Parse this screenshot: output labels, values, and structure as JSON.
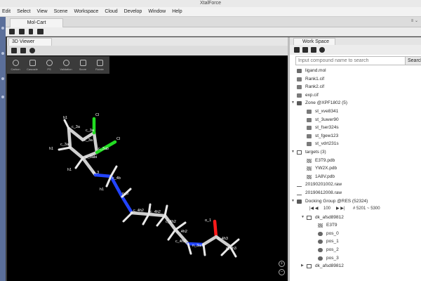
{
  "window_title": "XtalForce",
  "menu": [
    "Edit",
    "Select",
    "View",
    "Scene",
    "Workspace",
    "Cloud",
    "Develop",
    "Window",
    "Help"
  ],
  "main_tab": "Mol-Cart",
  "viewer": {
    "tab_label": "3D Viewer",
    "tools": [
      "Carbon",
      "Cascade",
      "PS",
      "Validation",
      "Score",
      "Rotate"
    ]
  },
  "workspace": {
    "tab_label": "Work Space",
    "search_placeholder": "Input compound name to search",
    "search_button": "Search",
    "pager": "100",
    "pager_range": "# 5201 ~ 5300",
    "items": [
      {
        "label": "ligand.mol",
        "icon": "mol",
        "level": 1,
        "arrow": ""
      },
      {
        "label": "Rank1.cif",
        "icon": "file",
        "level": 1,
        "arrow": ""
      },
      {
        "label": "Rank2.cif",
        "icon": "file",
        "level": 1,
        "arrow": ""
      },
      {
        "label": "exp.cif",
        "icon": "file",
        "level": 1,
        "arrow": ""
      },
      {
        "label": "Zone @XPF1802 (5)",
        "icon": "group",
        "level": 1,
        "arrow": "▼"
      },
      {
        "label": "st_xve8341",
        "icon": "file",
        "level": 2,
        "arrow": ""
      },
      {
        "label": "st_3uwer90",
        "icon": "file",
        "level": 2,
        "arrow": ""
      },
      {
        "label": "st_fser324s",
        "icon": "file",
        "level": 2,
        "arrow": ""
      },
      {
        "label": "st_fgew123",
        "icon": "file",
        "level": 2,
        "arrow": ""
      },
      {
        "label": "st_vdrt231s",
        "icon": "file",
        "level": 2,
        "arrow": ""
      },
      {
        "label": "targets (3)",
        "icon": "folder",
        "level": 1,
        "arrow": "▼"
      },
      {
        "label": "E3T9.pdb",
        "icon": "pdb",
        "level": 2,
        "arrow": ""
      },
      {
        "label": "YW2X.pdb",
        "icon": "pdb",
        "level": 2,
        "arrow": ""
      },
      {
        "label": "1A8V.pdb",
        "icon": "pdb",
        "level": 2,
        "arrow": ""
      },
      {
        "label": "20190201002.raw",
        "icon": "raw",
        "level": 1,
        "arrow": ""
      },
      {
        "label": "20190612008.raw",
        "icon": "raw",
        "level": 1,
        "arrow": ""
      },
      {
        "label": "Docking Group @RES (52324)",
        "icon": "group",
        "level": 1,
        "arrow": "▼"
      },
      {
        "label": "",
        "icon": "pager",
        "level": 2,
        "arrow": ""
      },
      {
        "label": "dk_afsd89812",
        "icon": "dk",
        "level": 2,
        "arrow": "▼"
      },
      {
        "label": "E3T9",
        "icon": "pdb",
        "level": 3,
        "arrow": ""
      },
      {
        "label": "pos_0",
        "icon": "pose",
        "level": 3,
        "arrow": ""
      },
      {
        "label": "pos_1",
        "icon": "pose",
        "level": 3,
        "arrow": ""
      },
      {
        "label": "pos_2",
        "icon": "pose",
        "level": 3,
        "arrow": ""
      },
      {
        "label": "pos_3",
        "icon": "pose",
        "level": 3,
        "arrow": ""
      },
      {
        "label": "dk_afsd89812",
        "icon": "dk",
        "level": 2,
        "arrow": "▶"
      }
    ]
  },
  "atom_labels": [
    "Cl",
    "Cl",
    "c_3a",
    "c_3a",
    "c_3a",
    "c_3a",
    "c_3ab",
    "c_3abi",
    "n_3",
    "n_3",
    "c_4b",
    "c_4h2",
    "c_4h2",
    "c_4h2",
    "c_4h2",
    "c_4h2",
    "n_3am",
    "c_4h3",
    "o_1",
    "c_4h3",
    "h1",
    "h1",
    "h1",
    "h1"
  ],
  "colors": {
    "chlorine": "#22dd22",
    "nitrogen": "#2244ff",
    "oxygen": "#ff1a1a",
    "carbon": "#cfcfcf",
    "hydrogen": "#e8e8e8"
  }
}
